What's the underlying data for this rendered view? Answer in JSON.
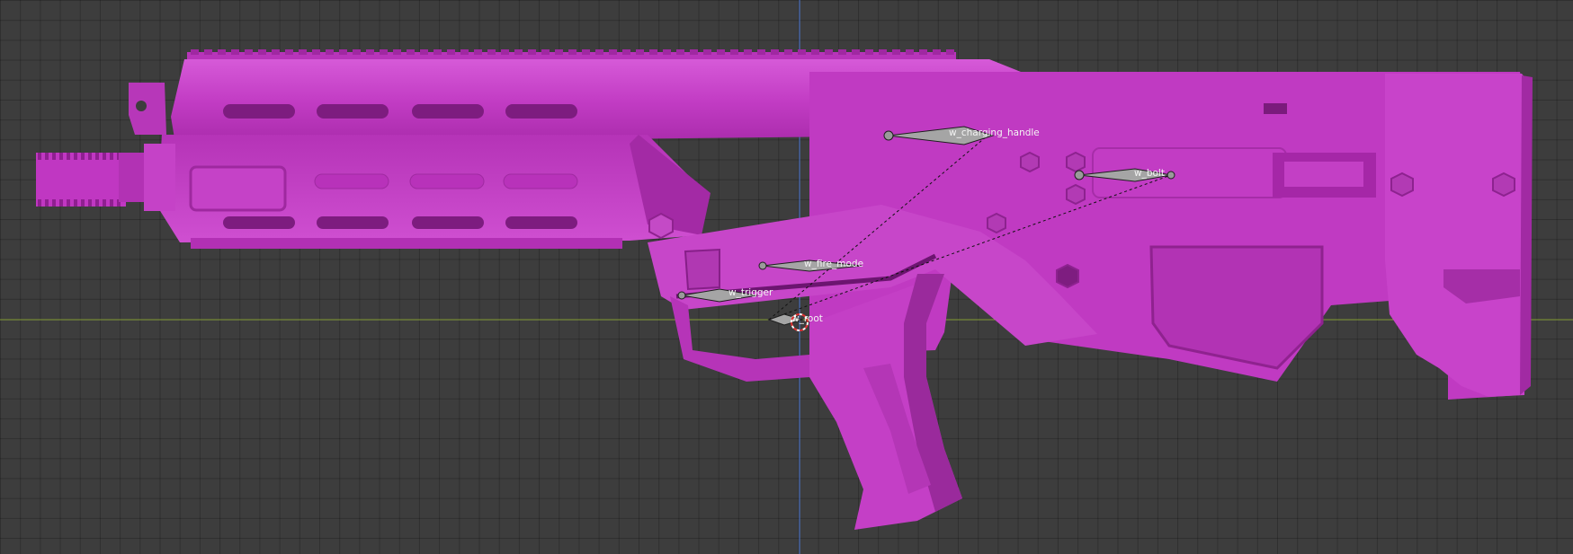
{
  "viewport": {
    "background_color": "#3d3d3d",
    "grid_color": "#333333",
    "x_axis_color": "#8aa33a",
    "y_axis_color": "#4f7ad6",
    "model_color": "#c23cc4"
  },
  "bones": {
    "charging_handle": "w_charging_handle",
    "bolt": "w_bolt",
    "fire_mode": "w_fire_mode",
    "trigger": "w_trigger",
    "root": "w_root"
  }
}
